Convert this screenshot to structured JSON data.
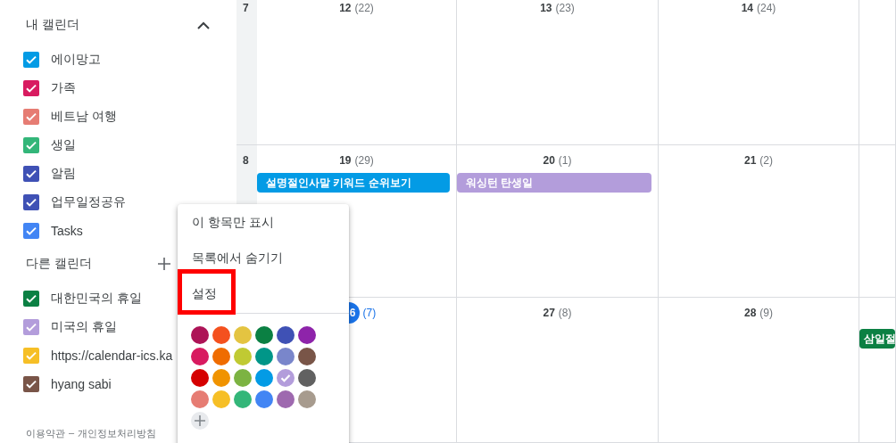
{
  "sidebar": {
    "my_calendars": {
      "title": "내 캘린더",
      "expanded": true,
      "items": [
        {
          "label": "에이망고",
          "checked": true,
          "color": "#039be5"
        },
        {
          "label": "가족",
          "checked": true,
          "color": "#d81b60"
        },
        {
          "label": "베트남 여행",
          "checked": true,
          "color": "#e67c73"
        },
        {
          "label": "생일",
          "checked": true,
          "color": "#33b679"
        },
        {
          "label": "알림",
          "checked": true,
          "color": "#3f51b5"
        },
        {
          "label": "업무일정공유",
          "checked": true,
          "color": "#3f51b5"
        },
        {
          "label": "Tasks",
          "checked": true,
          "color": "#4285f4"
        }
      ]
    },
    "other_calendars": {
      "title": "다른 캘린더",
      "items": [
        {
          "label": "대한민국의 휴일",
          "checked": true,
          "color": "#0b8043"
        },
        {
          "label": "미국의 휴일",
          "checked": true,
          "color": "#b39ddb"
        },
        {
          "label": "https://calendar-ics.ka",
          "checked": true,
          "color": "#f6bf26"
        },
        {
          "label": "hyang sabi",
          "checked": true,
          "color": "#795548"
        }
      ]
    },
    "footer": {
      "links": [
        "이용약관",
        "개인정보처리방침"
      ],
      "separator": "–"
    }
  },
  "grid": {
    "weeks": [
      {
        "week": "7",
        "days": [
          {
            "date": "12",
            "lunar": "(22)",
            "today": false
          },
          {
            "date": "13",
            "lunar": "(23)",
            "today": false
          },
          {
            "date": "14",
            "lunar": "(24)",
            "today": false
          }
        ]
      },
      {
        "week": "8",
        "days": [
          {
            "date": "19",
            "lunar": "(29)",
            "today": false,
            "events": [
              {
                "title": "설명절인사말 키워드 순위보기",
                "color": "#039be5"
              }
            ]
          },
          {
            "date": "20",
            "lunar": "(1)",
            "today": false,
            "events": [
              {
                "title": "워싱턴 탄생일",
                "color": "#b39ddb"
              }
            ]
          },
          {
            "date": "21",
            "lunar": "(2)",
            "today": false
          }
        ]
      },
      {
        "days": [
          {
            "date": "6",
            "lunar": "(7)",
            "today": true
          },
          {
            "date": "27",
            "lunar": "(8)",
            "today": false
          },
          {
            "date": "28",
            "lunar": "(9)",
            "today": false
          },
          {
            "events": [
              {
                "title": "삼일절",
                "color": "#0b8043"
              }
            ]
          }
        ]
      }
    ]
  },
  "menu": {
    "items": [
      {
        "label": "이 항목만 표시",
        "highlighted": false
      },
      {
        "label": "목록에서 숨기기",
        "highlighted": false
      },
      {
        "label": "설정",
        "highlighted": true
      }
    ],
    "palette": [
      {
        "color": "#ad1457",
        "selected": false
      },
      {
        "color": "#f4511e",
        "selected": false
      },
      {
        "color": "#e4c441",
        "selected": false
      },
      {
        "color": "#0b8043",
        "selected": false
      },
      {
        "color": "#3f51b5",
        "selected": false
      },
      {
        "color": "#8e24aa",
        "selected": false
      },
      {
        "color": "#d81b60",
        "selected": false
      },
      {
        "color": "#ef6c00",
        "selected": false
      },
      {
        "color": "#c0ca33",
        "selected": false
      },
      {
        "color": "#009688",
        "selected": false
      },
      {
        "color": "#7986cb",
        "selected": false
      },
      {
        "color": "#795548",
        "selected": false
      },
      {
        "color": "#d50000",
        "selected": false
      },
      {
        "color": "#f09300",
        "selected": false
      },
      {
        "color": "#7cb342",
        "selected": false
      },
      {
        "color": "#039be5",
        "selected": false
      },
      {
        "color": "#b39ddb",
        "selected": true
      },
      {
        "color": "#616161",
        "selected": false
      },
      {
        "color": "#e67c73",
        "selected": false
      },
      {
        "color": "#f6bf26",
        "selected": false
      },
      {
        "color": "#33b679",
        "selected": false
      },
      {
        "color": "#4285f4",
        "selected": false
      },
      {
        "color": "#9e69af",
        "selected": false
      },
      {
        "color": "#a79b8e",
        "selected": false
      }
    ]
  }
}
